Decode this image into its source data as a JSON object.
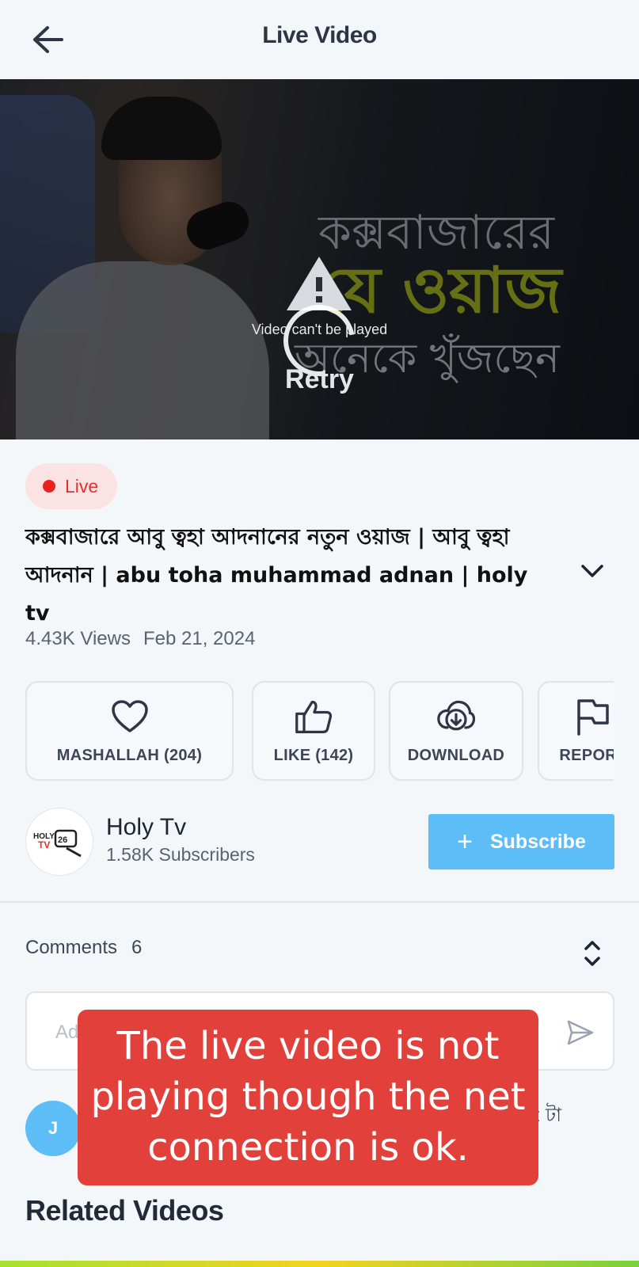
{
  "header": {
    "title": "Live Video",
    "back_icon": "arrow-left-icon"
  },
  "player": {
    "overlay_text_lines": [
      "কক্সবাজারের",
      "যে ওয়াজ",
      "অনেকে খুঁজছেন"
    ],
    "error_message": "Video can't be played",
    "retry_label": "Retry",
    "warning_icon": "warning-triangle-icon"
  },
  "video": {
    "live_label": "Live",
    "title": "কক্সবাজারে আবু ত্বহা আদনানের নতুন ওয়াজ | আবু ত্বহা আদনান | abu toha muhammad adnan | holy tv",
    "views": "4.43K Views",
    "date": "Feb 21, 2024"
  },
  "actions": [
    {
      "label": "MASHALLAH (204)",
      "icon": "heart-icon"
    },
    {
      "label": "LIKE (142)",
      "icon": "thumbs-up-icon"
    },
    {
      "label": "DOWNLOAD",
      "icon": "cloud-download-icon"
    },
    {
      "label": "REPORT",
      "icon": "flag-icon"
    }
  ],
  "channel": {
    "name": "Holy Tv",
    "subscribers": "1.58K Subscribers",
    "subscribe_label": "Subscribe",
    "logo_text": "HOLY TV 26"
  },
  "comments": {
    "label": "Comments",
    "count": "6",
    "input_placeholder": "Ad",
    "first_comment_initial": "J",
    "first_comment_tail": "t টা"
  },
  "related": {
    "title": "Related Videos"
  },
  "annotation": {
    "text": "The live video is not playing though the net connection is ok."
  },
  "colors": {
    "accent": "#5cbdf7",
    "live_red": "#ee1f1f",
    "note_red": "#e2403a"
  }
}
